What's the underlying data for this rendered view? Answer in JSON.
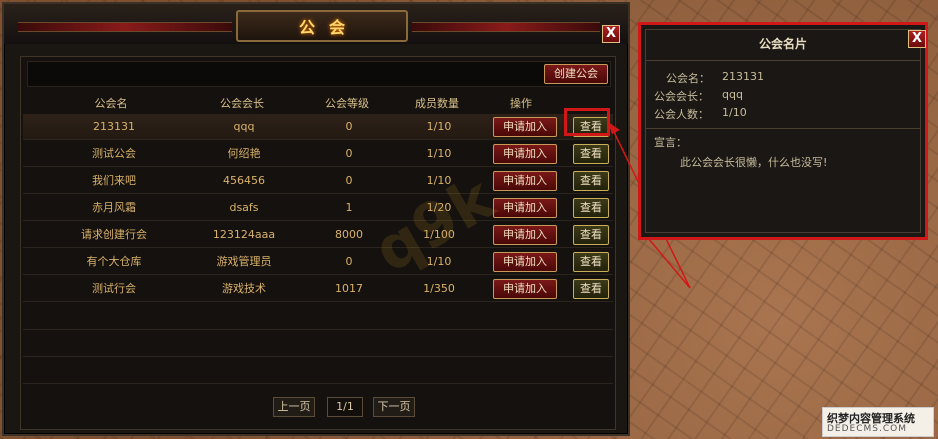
{
  "guild_window": {
    "title": "公会",
    "close_label": "X",
    "create_button": "创建公会",
    "columns": [
      "公会名",
      "公会会长",
      "公会等级",
      "成员数量",
      "操作"
    ],
    "join_label": "申请加入",
    "view_label": "查看",
    "rows": [
      {
        "name": "213131",
        "leader": "qqq",
        "level": "0",
        "members": "1/10"
      },
      {
        "name": "测试公会",
        "leader": "何绍艳",
        "level": "0",
        "members": "1/10"
      },
      {
        "name": "我们来吧",
        "leader": "456456",
        "level": "0",
        "members": "1/10"
      },
      {
        "name": "赤月风霜",
        "leader": "dsafs",
        "level": "1",
        "members": "1/20"
      },
      {
        "name": "请求创建行会",
        "leader": "123124aaa",
        "level": "8000",
        "members": "1/100"
      },
      {
        "name": "有个大仓库",
        "leader": "游戏管理员",
        "level": "0",
        "members": "1/10"
      },
      {
        "name": "测试行会",
        "leader": "游戏技术",
        "level": "1017",
        "members": "1/350"
      }
    ],
    "pager": {
      "prev": "上一页",
      "page": "1/1",
      "next": "下一页"
    }
  },
  "card_window": {
    "title": "公会名片",
    "close_label": "X",
    "name_label": "公会名：",
    "name_value": "213131",
    "leader_label": "公会会长：",
    "leader_value": "qqq",
    "count_label": "公会人数：",
    "count_value": "1/10",
    "decl_label": "宣言：",
    "decl_value": "此公会会长很懒，什么也没写!"
  },
  "watermark": "q9k",
  "footer": {
    "line1": "织梦内容管理系统",
    "line2": "DEDECMS.COM"
  },
  "colors": {
    "highlight": "#d01818",
    "text_gold": "#d9b26a"
  }
}
